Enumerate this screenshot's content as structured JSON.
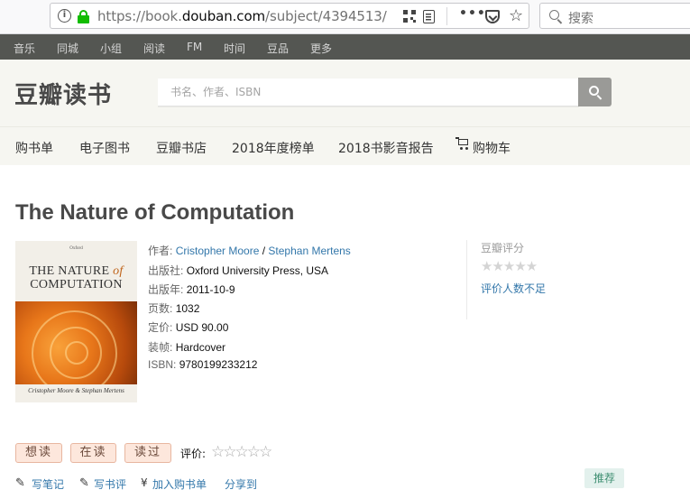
{
  "browser": {
    "url_prefix": "https://book.",
    "url_domain": "douban.com",
    "url_path": "/subject/4394513/",
    "search_placeholder": "搜索",
    "info_icon": "info-icon",
    "lock_icon": "lock-icon"
  },
  "topnav": [
    "音乐",
    "同城",
    "小组",
    "阅读",
    "FM",
    "时间",
    "豆品",
    "更多"
  ],
  "header": {
    "logo": "豆瓣读书",
    "search_placeholder": "书名、作者、ISBN"
  },
  "subnav": [
    "购书单",
    "电子图书",
    "豆瓣书店",
    "2018年度榜单",
    "2018书影音报告",
    "购物车"
  ],
  "book": {
    "title": "The Nature of Computation",
    "cover": {
      "publisher_top": "Oxford",
      "title_line1_a": "THE NATURE ",
      "title_line1_b": "of",
      "title_line2": "COMPUTATION",
      "authors": "Cristopher Moore & Stephan Mertens"
    },
    "info": {
      "author_label": "作者:",
      "author1": "Cristopher Moore",
      "author_sep": " / ",
      "author2": "Stephan Mertens",
      "publisher_label": "出版社:",
      "publisher": "Oxford University Press, USA",
      "date_label": "出版年:",
      "date": "2011-10-9",
      "pages_label": "页数:",
      "pages": "1032",
      "price_label": "定价:",
      "price": "USD 90.00",
      "binding_label": "装帧:",
      "binding": "Hardcover",
      "isbn_label": "ISBN:",
      "isbn": "9780199233212"
    }
  },
  "rating": {
    "label": "豆瓣评分",
    "stars": "★★★★★",
    "insufficient": "评价人数不足"
  },
  "actions": {
    "want": "想读",
    "reading": "在读",
    "read": "读过",
    "rate_label": "评价:",
    "rate_stars": "☆☆☆☆☆",
    "note": "写笔记",
    "review": "写书评",
    "cart": "加入购书单",
    "share": "分享到",
    "recommend": "推荐"
  }
}
